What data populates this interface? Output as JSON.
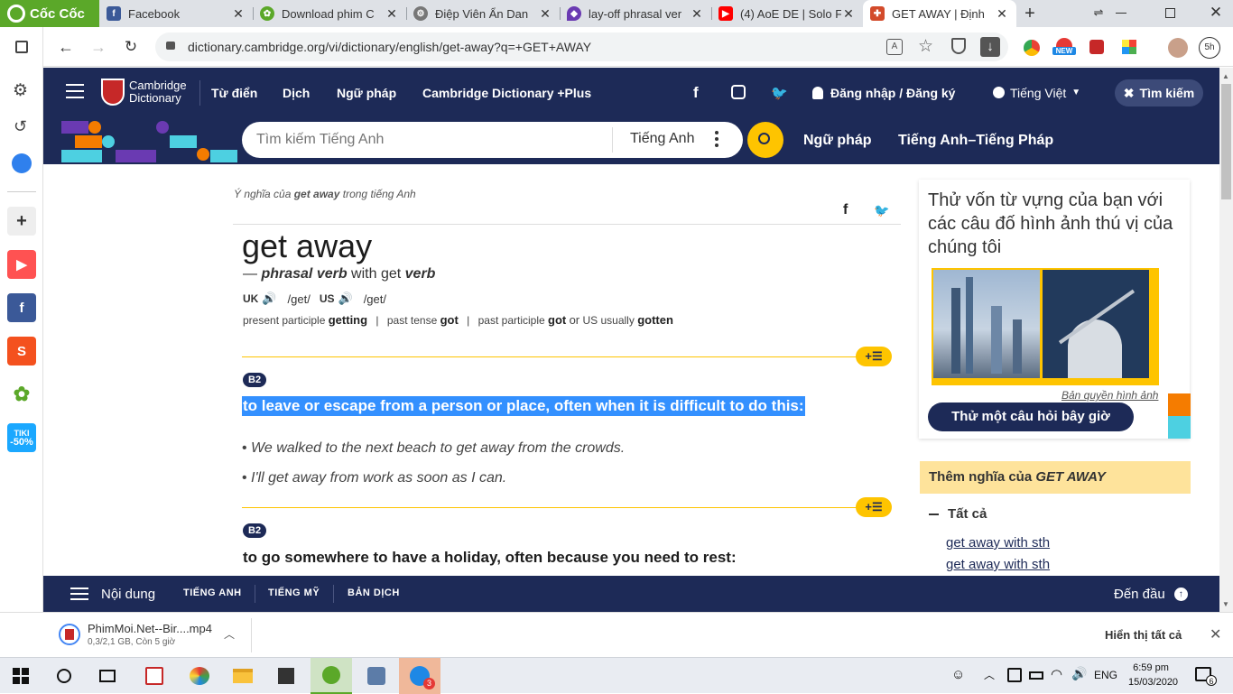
{
  "browser": {
    "brand": "Cốc Cốc",
    "tabs": [
      {
        "title": "Facebook",
        "icon": "facebook-icon",
        "color": "#3b5998"
      },
      {
        "title": "Download phim C",
        "icon": "coccoc-green-icon",
        "color": "#5ba829"
      },
      {
        "title": "Điệp Viên Ẩn Dan",
        "icon": "globe-gear-icon",
        "color": "#555555"
      },
      {
        "title": "lay-off phrasal ver",
        "icon": "shield-purple-icon",
        "color": "#6a3ab2"
      },
      {
        "title": "(4) AoE DE | Solo F",
        "icon": "youtube-icon",
        "color": "#ff0000"
      },
      {
        "title": "GET AWAY | Định",
        "icon": "cambridge-crest-icon",
        "color": "#d34b2b"
      }
    ],
    "new_tab": "+",
    "url": "dictionary.cambridge.org/vi/dictionary/english/get-away?q=+GET+AWAY",
    "ext_badge": "NEW",
    "time_badge": "5h"
  },
  "site": {
    "logo_line1": "Cambridge",
    "logo_line2": "Dictionary",
    "nav": [
      "Từ điển",
      "Dịch",
      "Ngữ pháp",
      "Cambridge Dictionary +Plus"
    ],
    "login": "Đăng nhập / Đăng ký",
    "language": "Tiếng Việt",
    "search_toggle": "Tìm kiếm",
    "search_placeholder": "Tìm kiếm Tiếng Anh",
    "search_lang": "Tiếng Anh",
    "sub_links": [
      "Ngữ pháp",
      "Tiếng Anh–Tiếng Pháp"
    ]
  },
  "entry": {
    "breadcrumb_pre": "Ý nghĩa của ",
    "breadcrumb_word": "get away",
    "breadcrumb_post": " trong tiếng Anh",
    "headword": "get away",
    "dash": "— ",
    "pos": "phrasal verb",
    "with": " with get ",
    "verb": "verb",
    "uk": "UK",
    "uk_ipa": "/get/",
    "us": "US",
    "us_ipa": "/get/",
    "inflections": {
      "pp_label": "present participle",
      "pp": "getting",
      "pt_label": "past tense",
      "pt": "got",
      "pastp_label": "past participle",
      "pastp": "got",
      "or": "or",
      "us_usually": "US usually",
      "alt": "gotten"
    },
    "add_button": "+☰",
    "senses": [
      {
        "level": "B2",
        "definition": "to leave or escape from a person or place, often when it is difficult to do this:",
        "examples": [
          "We walked to the next beach to get away from the crowds.",
          "I'll get away from work as soon as I can."
        ]
      },
      {
        "level": "B2",
        "definition": "to go somewhere to have a holiday, often because you need to rest:"
      }
    ]
  },
  "sidebar": {
    "quiz_title": "Thử vốn từ vựng của bạn với các câu đố hình ảnh thú vị của chúng tôi",
    "copyright": "Bản quyền hình ảnh",
    "quiz_button": "Thử một câu hỏi bây giờ",
    "more_pre": "Thêm nghĩa của ",
    "more_word": "GET AWAY",
    "all_label": "Tất cả",
    "links": [
      "get away with sth",
      "get away with sth"
    ]
  },
  "bottom_nav": {
    "contents": "Nội dung",
    "tabs": [
      "TIẾNG ANH",
      "TIẾNG MỸ",
      "BẢN DỊCH"
    ],
    "top": "Đến đầu"
  },
  "download": {
    "file": "PhimMoi.Net--Bir....mp4",
    "status": "0,3/2,1 GB, Còn 5 giờ",
    "show_all": "Hiển thị tất cả"
  },
  "taskbar": {
    "lang": "ENG",
    "time": "6:59 pm",
    "date": "15/03/2020",
    "zalo_badge": "3",
    "notif_count": "6"
  },
  "leftbar": {
    "tiki_line1": "TIKI",
    "tiki_line2": "-50%"
  },
  "colors": {
    "navy": "#1d2a57",
    "yellow": "#fec400",
    "highlight": "#3390ff"
  }
}
